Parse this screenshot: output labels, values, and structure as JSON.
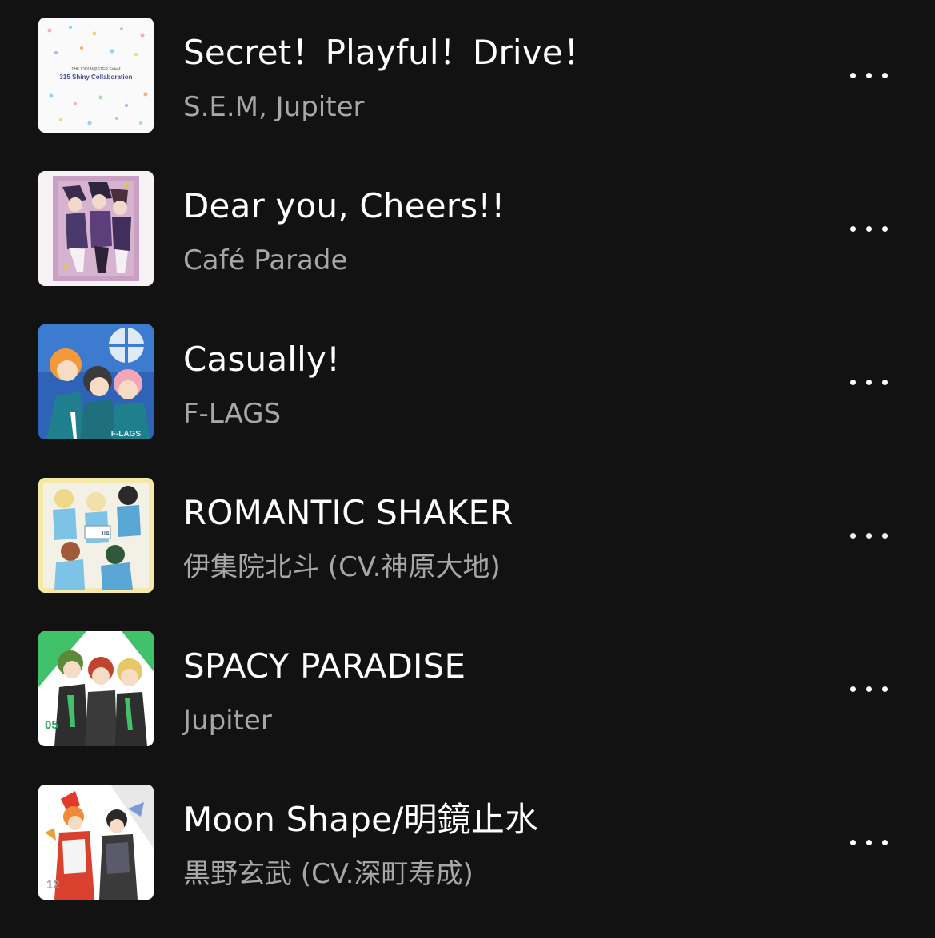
{
  "tracks": [
    {
      "title": "Secret！Playful！Drive！",
      "artist": "S.E.M, Jupiter",
      "cover_label": "315 Shiny Collaboration",
      "cover_top": "THE IDOLM@STER SideM"
    },
    {
      "title": "Dear you, Cheers!!",
      "artist": "Café Parade"
    },
    {
      "title": "Casually!",
      "artist": "F-LAGS",
      "cover_label": "F-LAGS"
    },
    {
      "title": "ROMANTIC SHAKER",
      "artist": "伊集院北斗 (CV.神原大地)",
      "cover_label": "04"
    },
    {
      "title": "SPACY PARADISE",
      "artist": "Jupiter",
      "cover_label": "05"
    },
    {
      "title": "Moon Shape/明鏡止水",
      "artist": "黒野玄武 (CV.深町寿成)",
      "cover_label": "12"
    }
  ],
  "icons": {
    "more": "more-horizontal-icon",
    "cover": "album-cover-art"
  },
  "colors": {
    "background": "#121212",
    "title": "#ffffff",
    "subtitle": "#a7a7a7"
  }
}
